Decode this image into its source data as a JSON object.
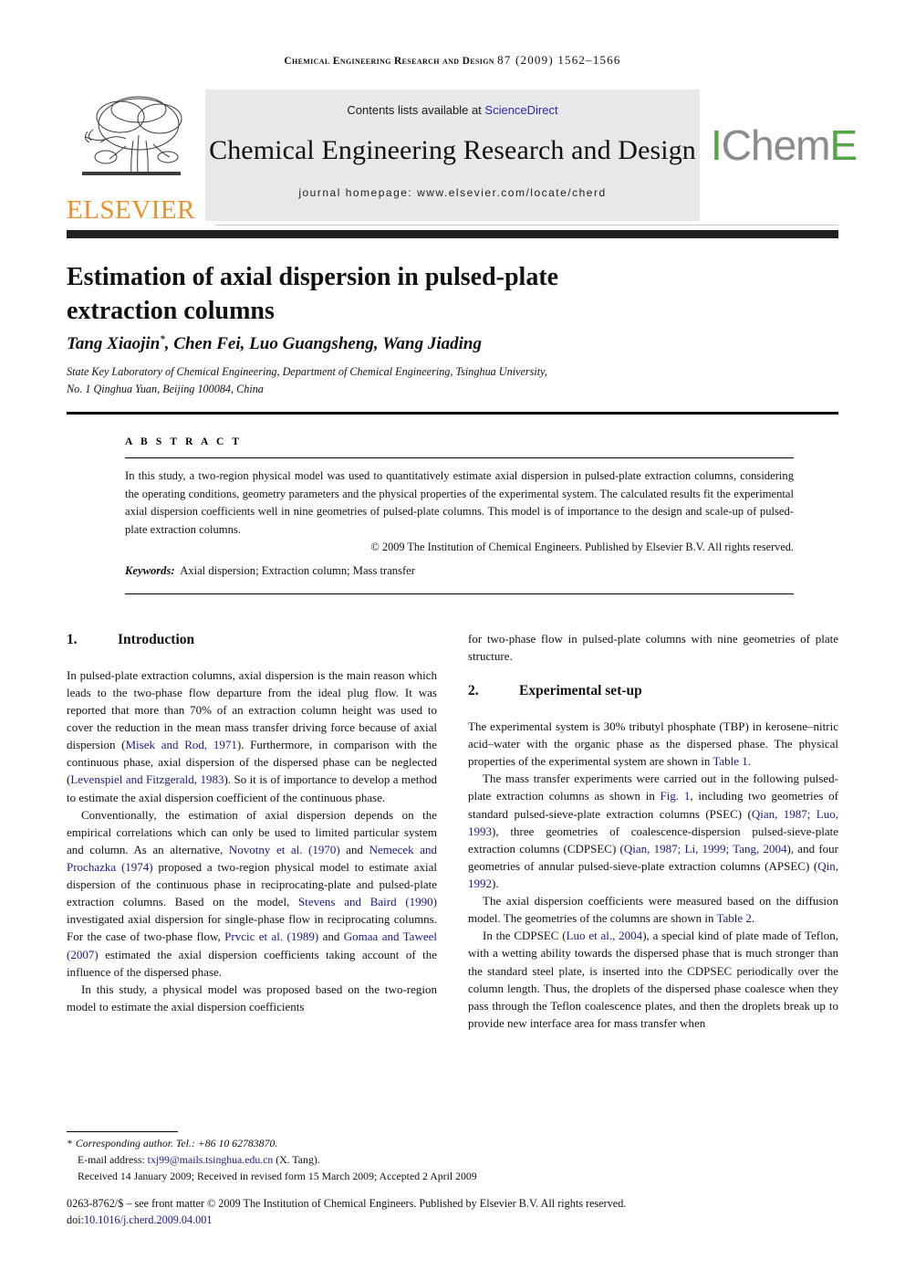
{
  "running_head": {
    "journal": "Chemical Engineering Research and Design",
    "volume_issue": "87 (2009) 1562–1566"
  },
  "masthead": {
    "publisher_logo_text": "ELSEVIER",
    "publisher_logo_color": "#F08E2C",
    "contents_prefix": "Contents lists available at ",
    "contents_link": "ScienceDirect",
    "contents_link_color": "#2a2ab0",
    "journal_title": "Chemical Engineering Research and Design",
    "journal_homepage": "journal homepage: www.elsevier.com/locate/cherd",
    "society_logo": {
      "part1": "I",
      "part2": "Chem",
      "part3": "E",
      "green": "#54a546",
      "gray": "#8b8b8b"
    }
  },
  "article": {
    "title": "Estimation of axial dispersion in pulsed-plate extraction columns",
    "authors": "Tang Xiaojin, Chen Fei, Luo Guangsheng, Wang Jiading",
    "corresponding_marker": "*",
    "affiliation_line1": "State Key Laboratory of Chemical Engineering, Department of Chemical Engineering, Tsinghua University,",
    "affiliation_line2": "No. 1 Qinghua Yuan, Beijing 100084, China"
  },
  "abstract": {
    "label": "A B S T R A C T",
    "body": "In this study, a two-region physical model was used to quantitatively estimate axial dispersion in pulsed-plate extraction columns, considering the operating conditions, geometry parameters and the physical properties of the experimental system. The calculated results fit the experimental axial dispersion coefficients well in nine geometries of pulsed-plate columns. This model is of importance to the design and scale-up of pulsed-plate extraction columns.",
    "copyright": "© 2009 The Institution of Chemical Engineers. Published by Elsevier B.V. All rights reserved.",
    "keywords_label": "Keywords:",
    "keywords_value": "Axial dispersion; Extraction column; Mass transfer"
  },
  "body": {
    "section1": {
      "number": "1.",
      "heading": "Introduction",
      "p1_a": "In pulsed-plate extraction columns, axial dispersion is the main reason which leads to the two-phase flow departure from the ideal plug flow. It was reported that more than 70% of an extraction column height was used to cover the reduction in the mean mass transfer driving force because of axial dispersion (",
      "p1_ref1": "Misek and Rod, 1971",
      "p1_b": "). Furthermore, in comparison with the continuous phase, axial dispersion of the dispersed phase can be neglected (",
      "p1_ref2": "Levenspiel and Fitzgerald, 1983",
      "p1_c": "). So it is of importance to develop a method to estimate the axial dispersion coefficient of the continuous phase.",
      "p2_a": "Conventionally, the estimation of axial dispersion depends on the empirical correlations which can only be used to limited particular system and column. As an alternative, ",
      "p2_ref1": "Novotny et al. (1970)",
      "p2_b": " and ",
      "p2_ref2": "Nemecek and Prochazka (1974)",
      "p2_c": " proposed a two-region physical model to estimate axial dispersion of the continuous phase in reciprocating-plate and pulsed-plate extraction columns. Based on the model, ",
      "p2_ref3": "Stevens and Baird (1990)",
      "p2_d": " investigated axial dispersion for single-phase flow in reciprocating columns. For the case of two-phase flow, ",
      "p2_ref4": "Prvcic et al. (1989)",
      "p2_e": " and ",
      "p2_ref5": "Gomaa and Taweel (2007)",
      "p2_f": " estimated the axial dispersion coefficients taking account of the influence of the dispersed phase.",
      "p3_a": "In this study, a physical model was proposed based on the two-region model to estimate the axial dispersion coefficients for two-phase flow in pulsed-plate columns with nine geometries of plate structure."
    },
    "section2": {
      "number": "2.",
      "heading": "Experimental set-up",
      "p1_a": "The experimental system is 30% tributyl phosphate (TBP) in kerosene–nitric acid–water with the organic phase as the dispersed phase. The physical properties of the experimental system are shown in ",
      "p1_ref1": "Table 1",
      "p1_b": ".",
      "p2_a": "The mass transfer experiments were carried out in the following pulsed-plate extraction columns as shown in ",
      "p2_ref1": "Fig. 1",
      "p2_b": ", including two geometries of standard pulsed-sieve-plate extraction columns (PSEC) (",
      "p2_ref2": "Qian, 1987; Luo, 1993",
      "p2_c": "), three geometries of coalescence-dispersion pulsed-sieve-plate extraction columns (CDPSEC) (",
      "p2_ref3": "Qian, 1987; Li, 1999; Tang, 2004",
      "p2_d": "), and four geometries of annular pulsed-sieve-plate extraction columns (APSEC) (",
      "p2_ref4": "Qin, 1992",
      "p2_e": ").",
      "p3_a": "The axial dispersion coefficients were measured based on the diffusion model. The geometries of the columns are shown in ",
      "p3_ref1": "Table 2",
      "p3_b": ".",
      "p4_a": "In the CDPSEC (",
      "p4_ref1": "Luo et al., 2004",
      "p4_b": "), a special kind of plate made of Teflon, with a wetting ability towards the dispersed phase that is much stronger than the standard steel plate, is inserted into the CDPSEC periodically over the column length. Thus, the droplets of the dispersed phase coalesce when they pass through the Teflon coalescence plates, and then the droplets break up to provide new interface area for mass transfer when"
    }
  },
  "footer": {
    "corresponding_star": "*",
    "corresponding_text": "Corresponding author. Tel.: +86 10 62783870.",
    "email_label": "E-mail address: ",
    "email_value": "txj99@mails.tsinghua.edu.cn",
    "email_suffix": " (X. Tang).",
    "history": "Received 14 January 2009; Received in revised form 15 March 2009; Accepted 2 April 2009",
    "issn_line": "0263-8762/$ – see front matter © 2009 The Institution of Chemical Engineers. Published by Elsevier B.V. All rights reserved.",
    "doi_label": "doi:",
    "doi_value": "10.1016/j.cherd.2009.04.001",
    "link_color": "#1a1a8c"
  }
}
